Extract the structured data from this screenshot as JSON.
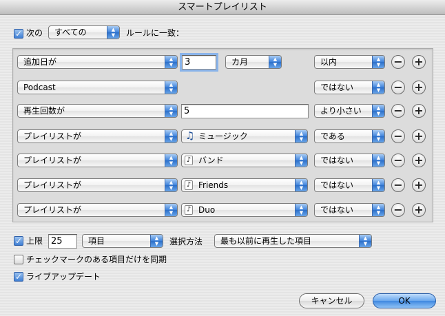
{
  "window": {
    "title": "スマートプレイリスト"
  },
  "match": {
    "checked": true,
    "prefix": "次の",
    "mode": "すべての",
    "suffix": "ルールに一致："
  },
  "rules": [
    {
      "field": "追加日が",
      "value": "3",
      "value2": "カ月",
      "op": "以内"
    },
    {
      "field": "Podcast",
      "op": "ではない"
    },
    {
      "field": "再生回数が",
      "value": "5",
      "op": "より小さい"
    },
    {
      "field": "プレイリストが",
      "value": "ミュージック",
      "value_icon": "music-note-icon",
      "op": "である"
    },
    {
      "field": "プレイリストが",
      "value": "バンド",
      "value_icon": "playlist-icon",
      "op": "ではない"
    },
    {
      "field": "プレイリストが",
      "value": "Friends",
      "value_icon": "playlist-icon",
      "op": "ではない"
    },
    {
      "field": "プレイリストが",
      "value": "Duo",
      "value_icon": "playlist-icon",
      "op": "ではない"
    }
  ],
  "limit": {
    "checked": true,
    "label": "上限",
    "value": "25",
    "unit": "項目",
    "selection_label": "選択方法",
    "selection": "最も以前に再生した項目"
  },
  "options": {
    "sync_checked_label": "チェックマークのある項目だけを同期",
    "sync_checked": false,
    "live_update_label": "ライブアップデート",
    "live_update": true
  },
  "buttons": {
    "cancel": "キャンセル",
    "ok": "OK"
  },
  "icons": {
    "minus": "−",
    "plus": "+",
    "check": "✓",
    "note": "♪",
    "music": "♫",
    "arrows": "▲▼"
  }
}
